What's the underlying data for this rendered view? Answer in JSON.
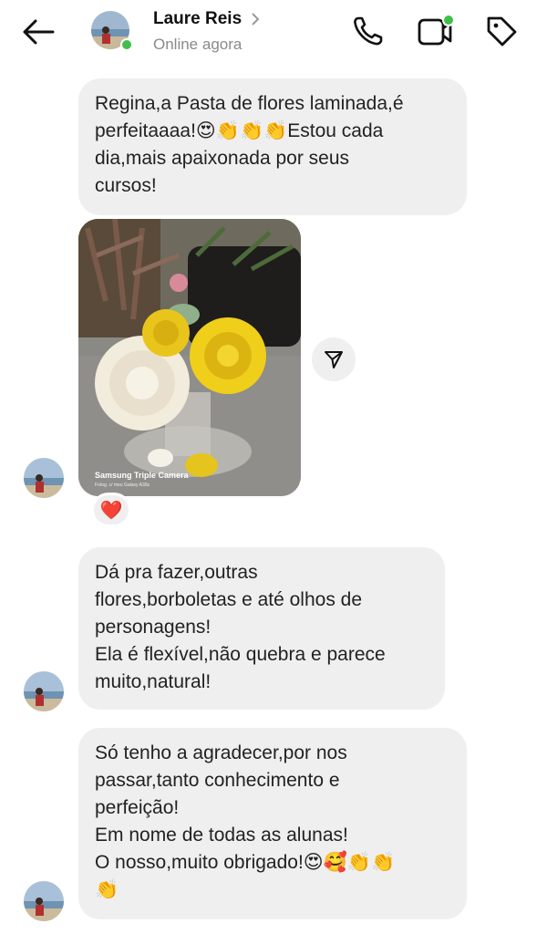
{
  "header": {
    "contact_name": "Laure Reis",
    "status": "Online agora",
    "icons": [
      "back-arrow-icon",
      "chevron-right-icon",
      "phone-icon",
      "video-call-icon",
      "tag-icon"
    ],
    "online_color": "#3fbf4a"
  },
  "messages": [
    {
      "type": "text",
      "text": "Regina,a Pasta de flores laminada,é\nperfeitaaaa!😍👏👏👏Estou cada\ndia,mais apaixonada por seus\ncursos!"
    },
    {
      "type": "image",
      "watermark_line1": "Samsung Triple Camera",
      "watermark_line2": "Fotog. c/ meu Galaxy A30s",
      "reaction": "❤️"
    },
    {
      "type": "text",
      "text": "Dá pra fazer,outras\nflores,borboletas e até olhos de\npersonagens!\nEla é flexível,não quebra e parece\nmuito,natural!"
    },
    {
      "type": "text",
      "text": "Só tenho a agradecer,por nos\npassar,tanto conhecimento e\nperfeição!\nEm nome de todas as alunas!\nO nosso,muito obrigado!😍🥰👏👏\n👏"
    }
  ],
  "colors": {
    "bubble": "#efefef",
    "status_text": "#8a8a8a",
    "reaction_heart": "#e0245e"
  }
}
